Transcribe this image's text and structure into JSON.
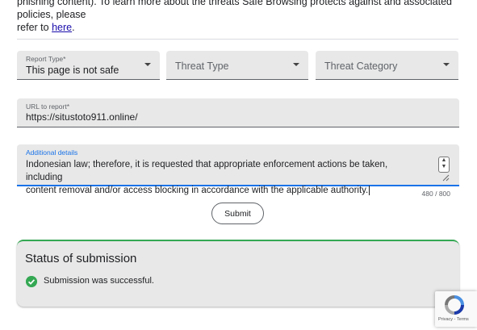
{
  "intro": {
    "line1": "phishing content). To learn more about the threats Safe Browsing protects against and associated policies, please",
    "line2_prefix": "refer to ",
    "link": "here",
    "line2_suffix": "."
  },
  "form": {
    "report_type": {
      "label": "Report Type*",
      "value": "This page is not safe"
    },
    "threat_type": {
      "placeholder": "Threat Type"
    },
    "threat_category": {
      "placeholder": "Threat Category"
    },
    "url": {
      "label": "URL to report*",
      "value": "https://situstoto911.online/"
    },
    "details": {
      "label": "Additional details",
      "line1": "Indonesian law; therefore, it is requested that appropriate enforcement actions be taken, including",
      "line2": "content removal and/or access blocking in accordance with the applicable authority."
    },
    "counter": "480 / 800",
    "submit_label": "Submit"
  },
  "status": {
    "title": "Status of submission",
    "message": "Submission was successful.",
    "accent_color": "#34a853"
  },
  "recaptcha": {
    "links": "Privacy - Terms"
  }
}
